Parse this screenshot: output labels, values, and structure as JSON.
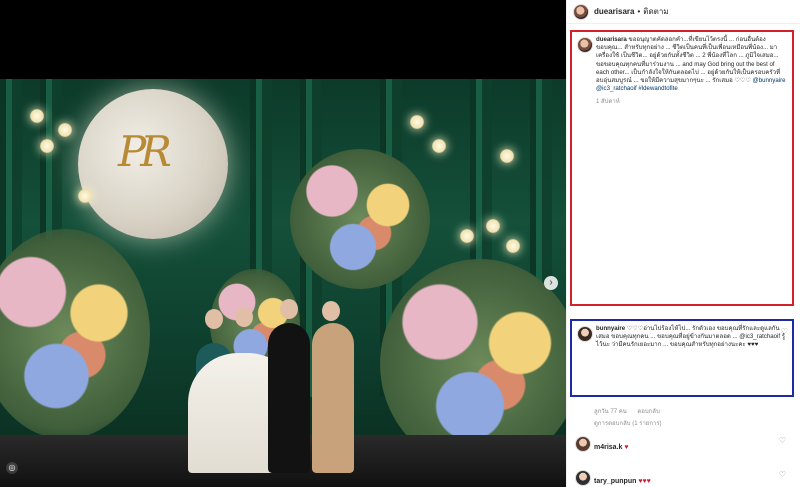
{
  "post": {
    "username": "duearisara",
    "follow_label": "ติดตาม",
    "separator": "•"
  },
  "caption": {
    "username": "duearisara",
    "text": "ขออนุญาตคัดลอกคำ...ที่เขียนไว้ตรงนี้ ... ก่อนอื่นต้องขอบคุณ... สำหรับทุกอย่าง ... ชีวิตเป็นคนที่เป็นเพื่อนเหมือนพี่น้อง... มาเครื่องใช้ เป็นชีวิต... อยู่ด้วยกันทั้งชีวิต ... 2 พี่น้องที่โลก ... ภูมิใจเสมอ... ขอขอบคุณทุกคนที่มาร่วมงาน ... and may God bring out the best of each other... เป็นกำลังใจให้กันตลอดไป ... อยู่ด้วยกันให้เป็นครอบครัวที่อบอุ่นสมบูรณ์ ... ขอให้มีความสุขมากๆนะ ... รักเสมอ ♡♡♡",
    "tags": "@bunnyaire @ic3_ratchaoif #ldewandtofite",
    "time": "1 สัปดาห์"
  },
  "reply": {
    "username": "bunnyaire",
    "text": "♡♡♡อ่านไปร้องไห้ไป... รักตัวเอง ขอบคุณที่รักและดูแลกันเสมอ ขอบคุณทุกคน ... ขอบคุณที่อยู่ข้างกันมาตลอด ... @ic3_ratchaoif รู้ไว้นะ ว่ามีคนรักเยอะมาก ... ขอบคุณสำหรับทุกอย่างนะคะ ♥♥♥",
    "time": "ลูกวัน 77 คน",
    "reply_label": "ตอบกลับ",
    "view_replies": "ดูการตอบกลับ (1 รายการ)"
  },
  "comments": [
    {
      "username": "m4risa.k",
      "text": "♥"
    },
    {
      "username": "tary_punpun",
      "text": "♥♥♥"
    }
  ],
  "icons": {
    "heart": "heart-icon",
    "next": "chevron-right-icon",
    "avatar": "avatar"
  },
  "colors": {
    "highlight_red": "#d4202a",
    "highlight_blue": "#1c2aa3",
    "heart_red": "#d11b36"
  }
}
